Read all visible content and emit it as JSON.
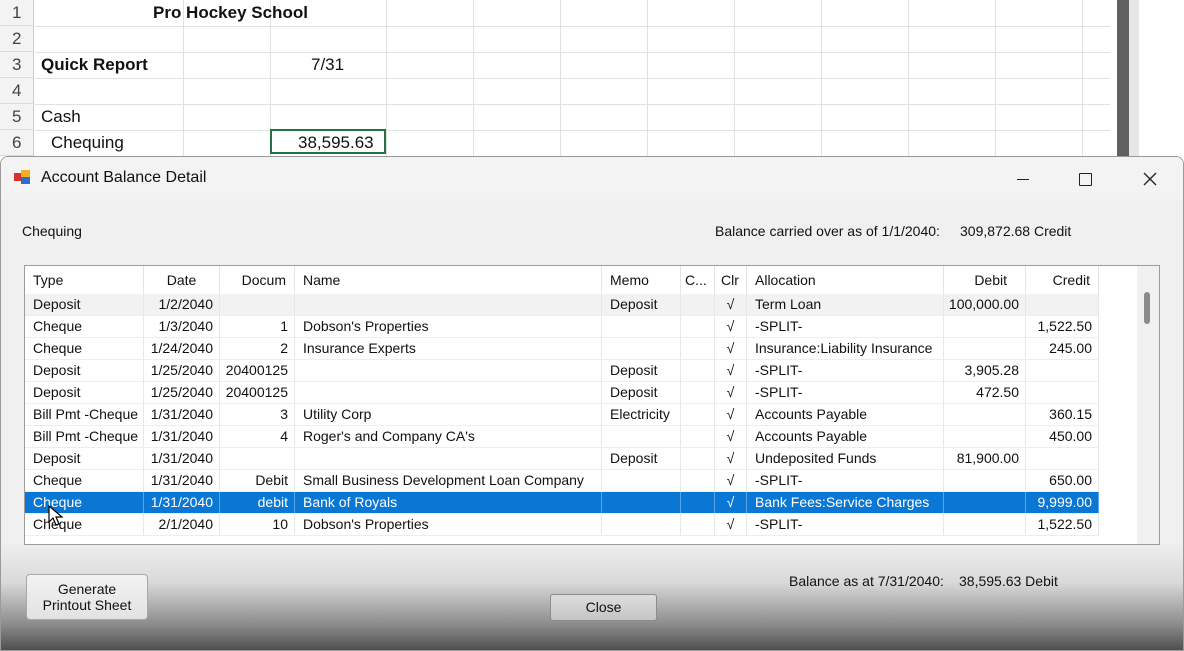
{
  "sheet": {
    "rows": [
      {
        "num": "1",
        "a": "",
        "b": "Pro Hockey School",
        "c": ""
      },
      {
        "num": "2",
        "a": "",
        "b": "",
        "c": ""
      },
      {
        "num": "3",
        "a": "Quick Report",
        "b": "",
        "c": "7/31"
      },
      {
        "num": "4",
        "a": "",
        "b": "",
        "c": ""
      },
      {
        "num": "5",
        "a": "Cash",
        "b": "",
        "c": ""
      },
      {
        "num": "6",
        "a": "Chequing",
        "b": "",
        "c": "38,595.63"
      }
    ]
  },
  "dialog": {
    "title": "Account Balance Detail",
    "account": "Chequing",
    "carried_label": "Balance carried over as of 1/1/2040:",
    "carried_value": "309,872.68 Credit",
    "columns": [
      "Type",
      "Date",
      "Docum",
      "Name",
      "Memo",
      "C...",
      "Clr",
      "Allocation",
      "Debit",
      "Credit"
    ],
    "rows": [
      {
        "type": "Deposit",
        "date": "1/2/2040",
        "doc": "",
        "name": "",
        "memo": "Deposit",
        "c": "",
        "clr": "√",
        "alloc": "Term Loan",
        "debit": "100,000.00",
        "credit": ""
      },
      {
        "type": "Cheque",
        "date": "1/3/2040",
        "doc": "1",
        "name": "Dobson's Properties",
        "memo": "",
        "c": "",
        "clr": "√",
        "alloc": "-SPLIT-",
        "debit": "",
        "credit": "1,522.50"
      },
      {
        "type": "Cheque",
        "date": "1/24/2040",
        "doc": "2",
        "name": "Insurance Experts",
        "memo": "",
        "c": "",
        "clr": "√",
        "alloc": "Insurance:Liability Insurance",
        "debit": "",
        "credit": "245.00"
      },
      {
        "type": "Deposit",
        "date": "1/25/2040",
        "doc": "20400125",
        "name": "",
        "memo": "Deposit",
        "c": "",
        "clr": "√",
        "alloc": "-SPLIT-",
        "debit": "3,905.28",
        "credit": ""
      },
      {
        "type": "Deposit",
        "date": "1/25/2040",
        "doc": "20400125",
        "name": "",
        "memo": "Deposit",
        "c": "",
        "clr": "√",
        "alloc": "-SPLIT-",
        "debit": "472.50",
        "credit": ""
      },
      {
        "type": "Bill Pmt -Cheque",
        "date": "1/31/2040",
        "doc": "3",
        "name": "Utility Corp",
        "memo": "Electricity",
        "c": "",
        "clr": "√",
        "alloc": "Accounts Payable",
        "debit": "",
        "credit": "360.15"
      },
      {
        "type": "Bill Pmt -Cheque",
        "date": "1/31/2040",
        "doc": "4",
        "name": "Roger's and Company CA's",
        "memo": "",
        "c": "",
        "clr": "√",
        "alloc": "Accounts Payable",
        "debit": "",
        "credit": "450.00"
      },
      {
        "type": "Deposit",
        "date": "1/31/2040",
        "doc": "",
        "name": "",
        "memo": "Deposit",
        "c": "",
        "clr": "√",
        "alloc": "Undeposited Funds",
        "debit": "81,900.00",
        "credit": ""
      },
      {
        "type": "Cheque",
        "date": "1/31/2040",
        "doc": "Debit",
        "name": "Small Business Development Loan Company",
        "memo": "",
        "c": "",
        "clr": "√",
        "alloc": "-SPLIT-",
        "debit": "",
        "credit": "650.00"
      },
      {
        "type": "Cheque",
        "date": "1/31/2040",
        "doc": "debit",
        "name": "Bank of Royals",
        "memo": "",
        "c": "",
        "clr": "√",
        "alloc": "Bank Fees:Service Charges",
        "debit": "",
        "credit": "9,999.00"
      },
      {
        "type": "Cheque",
        "date": "2/1/2040",
        "doc": "10",
        "name": "Dobson's Properties",
        "memo": "",
        "c": "",
        "clr": "√",
        "alloc": "-SPLIT-",
        "debit": "",
        "credit": "1,522.50"
      }
    ],
    "selected_row": 9,
    "generate_label_1": "Generate",
    "generate_label_2": "Printout Sheet",
    "close_label": "Close",
    "balance_label": "Balance as at 7/31/2040:",
    "balance_value": "38,595.63 Debit"
  },
  "colors": {
    "selection": "#0b77d4",
    "excel_green": "#217346"
  }
}
